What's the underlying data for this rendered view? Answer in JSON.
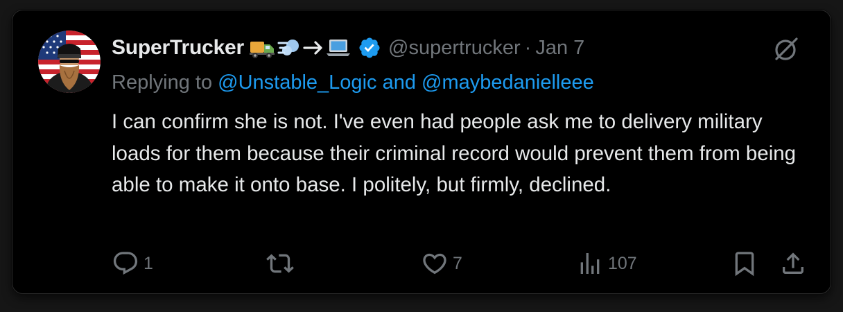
{
  "tweet": {
    "display_name": "SuperTrucker",
    "name_emojis": [
      "truck-emoji",
      "dash-emoji",
      "arrow-right",
      "laptop-emoji"
    ],
    "handle": "@supertrucker",
    "separator": "·",
    "date": "Jan 7",
    "reply_prefix": "Replying to ",
    "reply_targets": "@Unstable_Logic and @maybedanielleee",
    "text": "I can confirm she is not. I've even had people ask me to delivery military loads for them because their criminal record would prevent them from being able to make it onto base. I politely, but firmly, declined.",
    "metrics": {
      "replies": "1",
      "reposts": "",
      "likes": "7",
      "views": "107"
    }
  },
  "icons": {
    "verified": "verified-badge-icon",
    "grok": "grok-icon",
    "reply": "reply-icon",
    "repost": "repost-icon",
    "like": "heart-icon",
    "views": "views-icon",
    "bookmark": "bookmark-icon",
    "share": "share-icon"
  },
  "colors": {
    "background": "#000000",
    "text_primary": "#e7e9ea",
    "text_secondary": "#71767b",
    "accent": "#1d9bf0"
  }
}
